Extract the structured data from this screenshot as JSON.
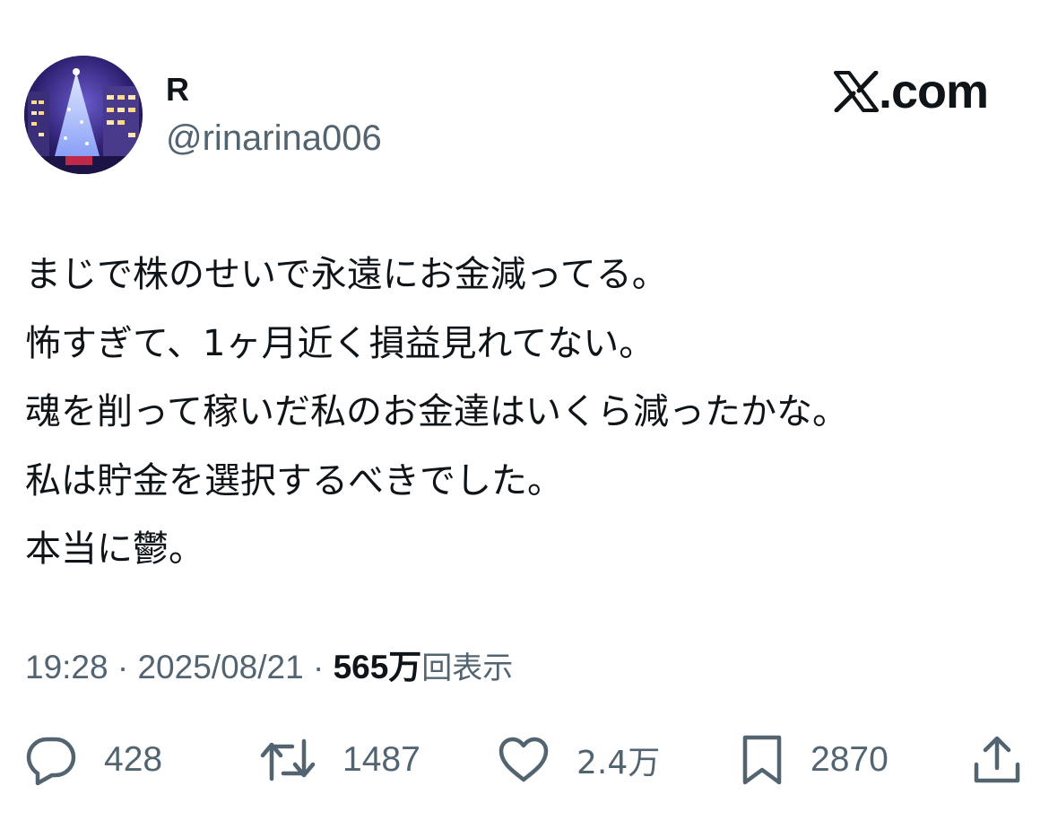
{
  "author": {
    "name": "R",
    "handle": "@rinarina006"
  },
  "brand": {
    "text": ".com"
  },
  "tweet": {
    "lines": [
      "まじで株のせいで永遠にお金減ってる。",
      "怖すぎて、1ヶ月近く損益見れてない。",
      "魂を削って稼いだ私のお金達はいくら減ったかな。",
      "私は貯金を選択するべきでした。",
      "本当に鬱。"
    ]
  },
  "meta": {
    "time": "19:28",
    "separator1": " · ",
    "date": "2025/08/21",
    "separator2": " · ",
    "views_count": "565万",
    "views_label": "回表示"
  },
  "actions": {
    "replies": "428",
    "reposts": "1487",
    "likes": "2.4万",
    "bookmarks": "2870"
  },
  "colors": {
    "text_primary": "#0f1419",
    "text_secondary": "#536471",
    "background": "#ffffff"
  },
  "icons": {
    "reply": "speech-bubble-icon",
    "repost": "repost-arrows-icon",
    "like": "heart-icon",
    "bookmark": "bookmark-icon",
    "share": "share-upload-icon",
    "brand": "x-logo-icon"
  }
}
